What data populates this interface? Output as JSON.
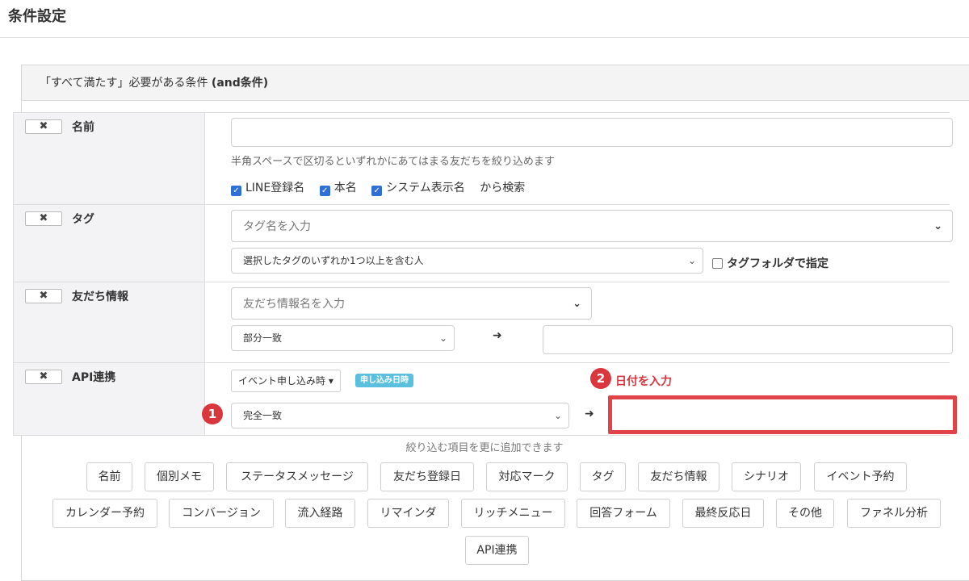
{
  "page": {
    "title": "条件設定"
  },
  "panel": {
    "head_prefix": "「すべて満たす」必要がある条件 ",
    "head_bold": "(and条件)"
  },
  "rows": {
    "name": {
      "remove": "✖",
      "label": "名前",
      "input_placeholder": "",
      "help": "半角スペースで区切るといずれかにあてはまる友だちを絞り込めます",
      "checks": [
        "LINE登録名",
        "本名",
        "システム表示名"
      ],
      "checks_suffix": "から検索"
    },
    "tag": {
      "remove": "✖",
      "label": "タグ",
      "input_placeholder": "タグ名を入力",
      "select_value": "選択したタグのいずれか1つ以上を含む人",
      "folder_label": "タグフォルダで指定"
    },
    "friend_info": {
      "remove": "✖",
      "label": "友だち情報",
      "input_placeholder": "友だち情報名を入力",
      "select_value": "部分一致"
    },
    "api": {
      "remove": "✖",
      "label": "API連携",
      "event_button": "イベント申し込み時 ▾",
      "badge": "申し込み日時",
      "select_value": "完全一致",
      "marker1": "1",
      "marker2": "2",
      "marker2_text": "日付を入力"
    }
  },
  "icons": {
    "chevron": "chevron-down-icon",
    "arrow": "arrow-right-icon",
    "remove": "close-icon",
    "checkbox": "check-icon"
  },
  "add_hint": "絞り込む項目を更に追加できます",
  "chips_row1": [
    "名前",
    "個別メモ",
    "ステータスメッセージ",
    "友だち登録日",
    "対応マーク",
    "タグ",
    "友だち情報",
    "シナリオ",
    "イベント予約"
  ],
  "chips_row2": [
    "カレンダー予約",
    "コンバージョン",
    "流入経路",
    "リマインダ",
    "リッチメニュー",
    "回答フォーム",
    "最終反応日",
    "その他",
    "ファネル分析"
  ],
  "chips_row3": [
    "API連携"
  ],
  "colors": {
    "accent_red": "#e04449",
    "badge_blue": "#5bc0de",
    "check_blue": "#2f6fd6"
  }
}
